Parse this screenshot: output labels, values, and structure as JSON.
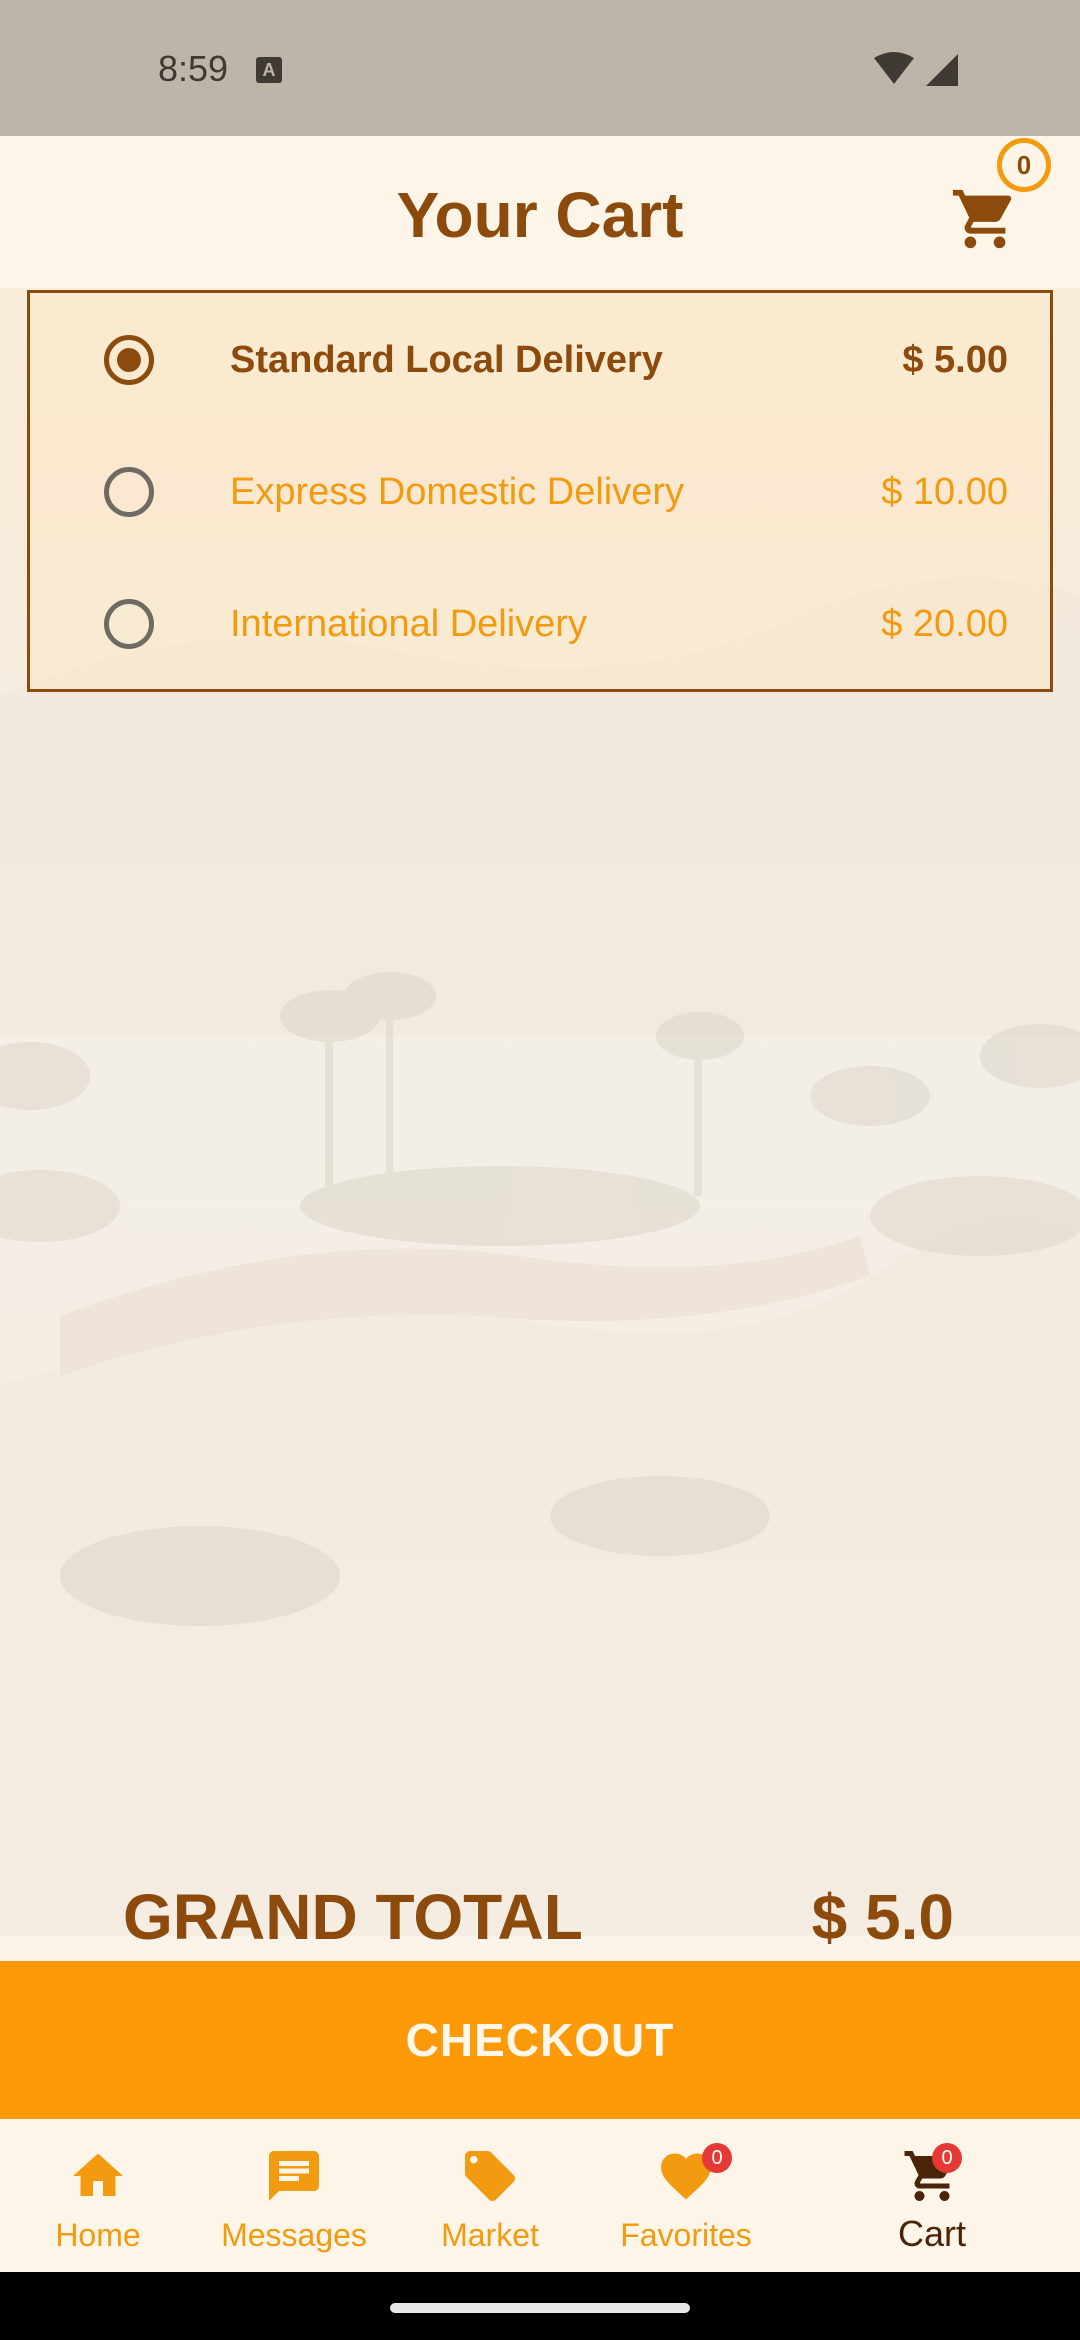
{
  "status_bar": {
    "time": "8:59",
    "notification_icon": "a-letter-icon"
  },
  "header": {
    "title": "Your Cart",
    "cart_badge_count": "0"
  },
  "delivery_options": [
    {
      "label": "Standard Local Delivery",
      "price": "$ 5.00",
      "selected": true
    },
    {
      "label": "Express Domestic Delivery",
      "price": "$ 10.00",
      "selected": false
    },
    {
      "label": "International Delivery",
      "price": "$ 20.00",
      "selected": false
    }
  ],
  "summary": {
    "grand_total_label": "GRAND TOTAL",
    "grand_total_value": "$ 5.0"
  },
  "checkout": {
    "label": "CHECKOUT"
  },
  "bottom_nav": {
    "items": [
      {
        "label": "Home",
        "icon": "home-icon"
      },
      {
        "label": "Messages",
        "icon": "message-icon"
      },
      {
        "label": "Market",
        "icon": "tag-icon"
      },
      {
        "label": "Favorites",
        "icon": "heart-icon",
        "badge": "0"
      },
      {
        "label": "Cart",
        "icon": "cart-icon",
        "badge": "0",
        "active": true
      }
    ]
  },
  "colors": {
    "brand_brown": "#8c4a0c",
    "brand_orange": "#f29a10",
    "checkout_orange": "#fd9a09",
    "badge_red": "#e53935"
  }
}
